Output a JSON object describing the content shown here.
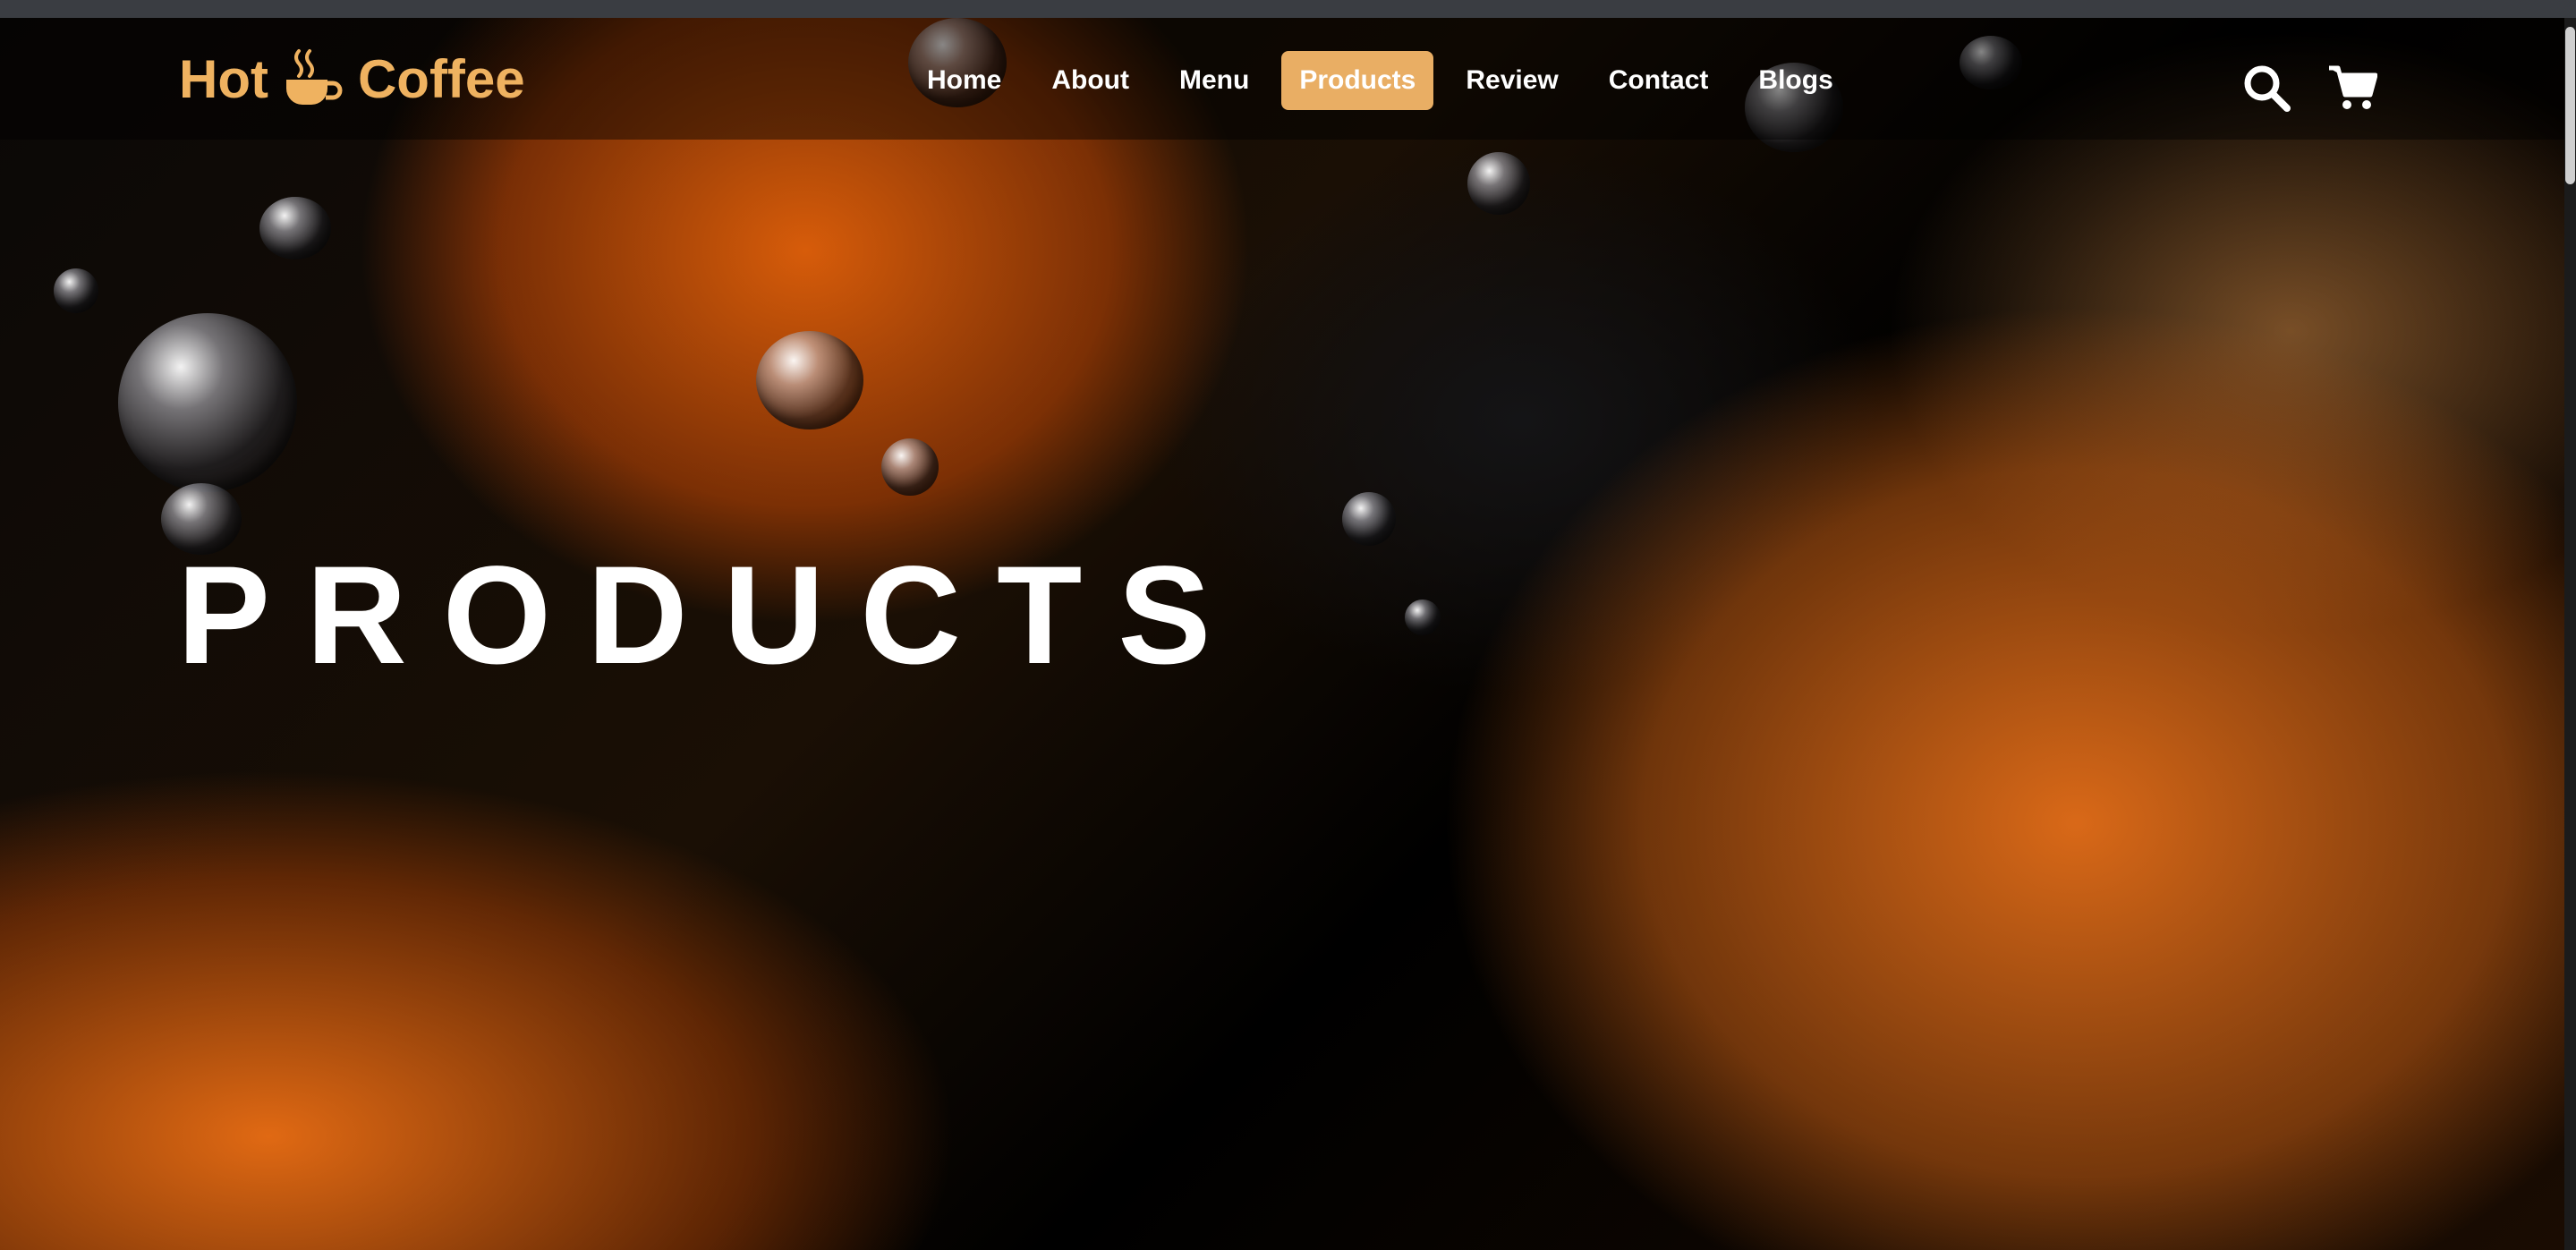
{
  "brand": {
    "name_left": "Hot",
    "name_right": "Coffee",
    "color": "#efb260"
  },
  "nav": {
    "items": [
      {
        "label": "Home"
      },
      {
        "label": "About"
      },
      {
        "label": "Menu"
      },
      {
        "label": "Products",
        "active": true
      },
      {
        "label": "Review"
      },
      {
        "label": "Contact"
      },
      {
        "label": "Blogs"
      }
    ],
    "active_color": "#e9ae64"
  },
  "icons": {
    "search": "search-icon",
    "cart": "cart-icon"
  },
  "hero": {
    "title": "PRODUCTS"
  }
}
